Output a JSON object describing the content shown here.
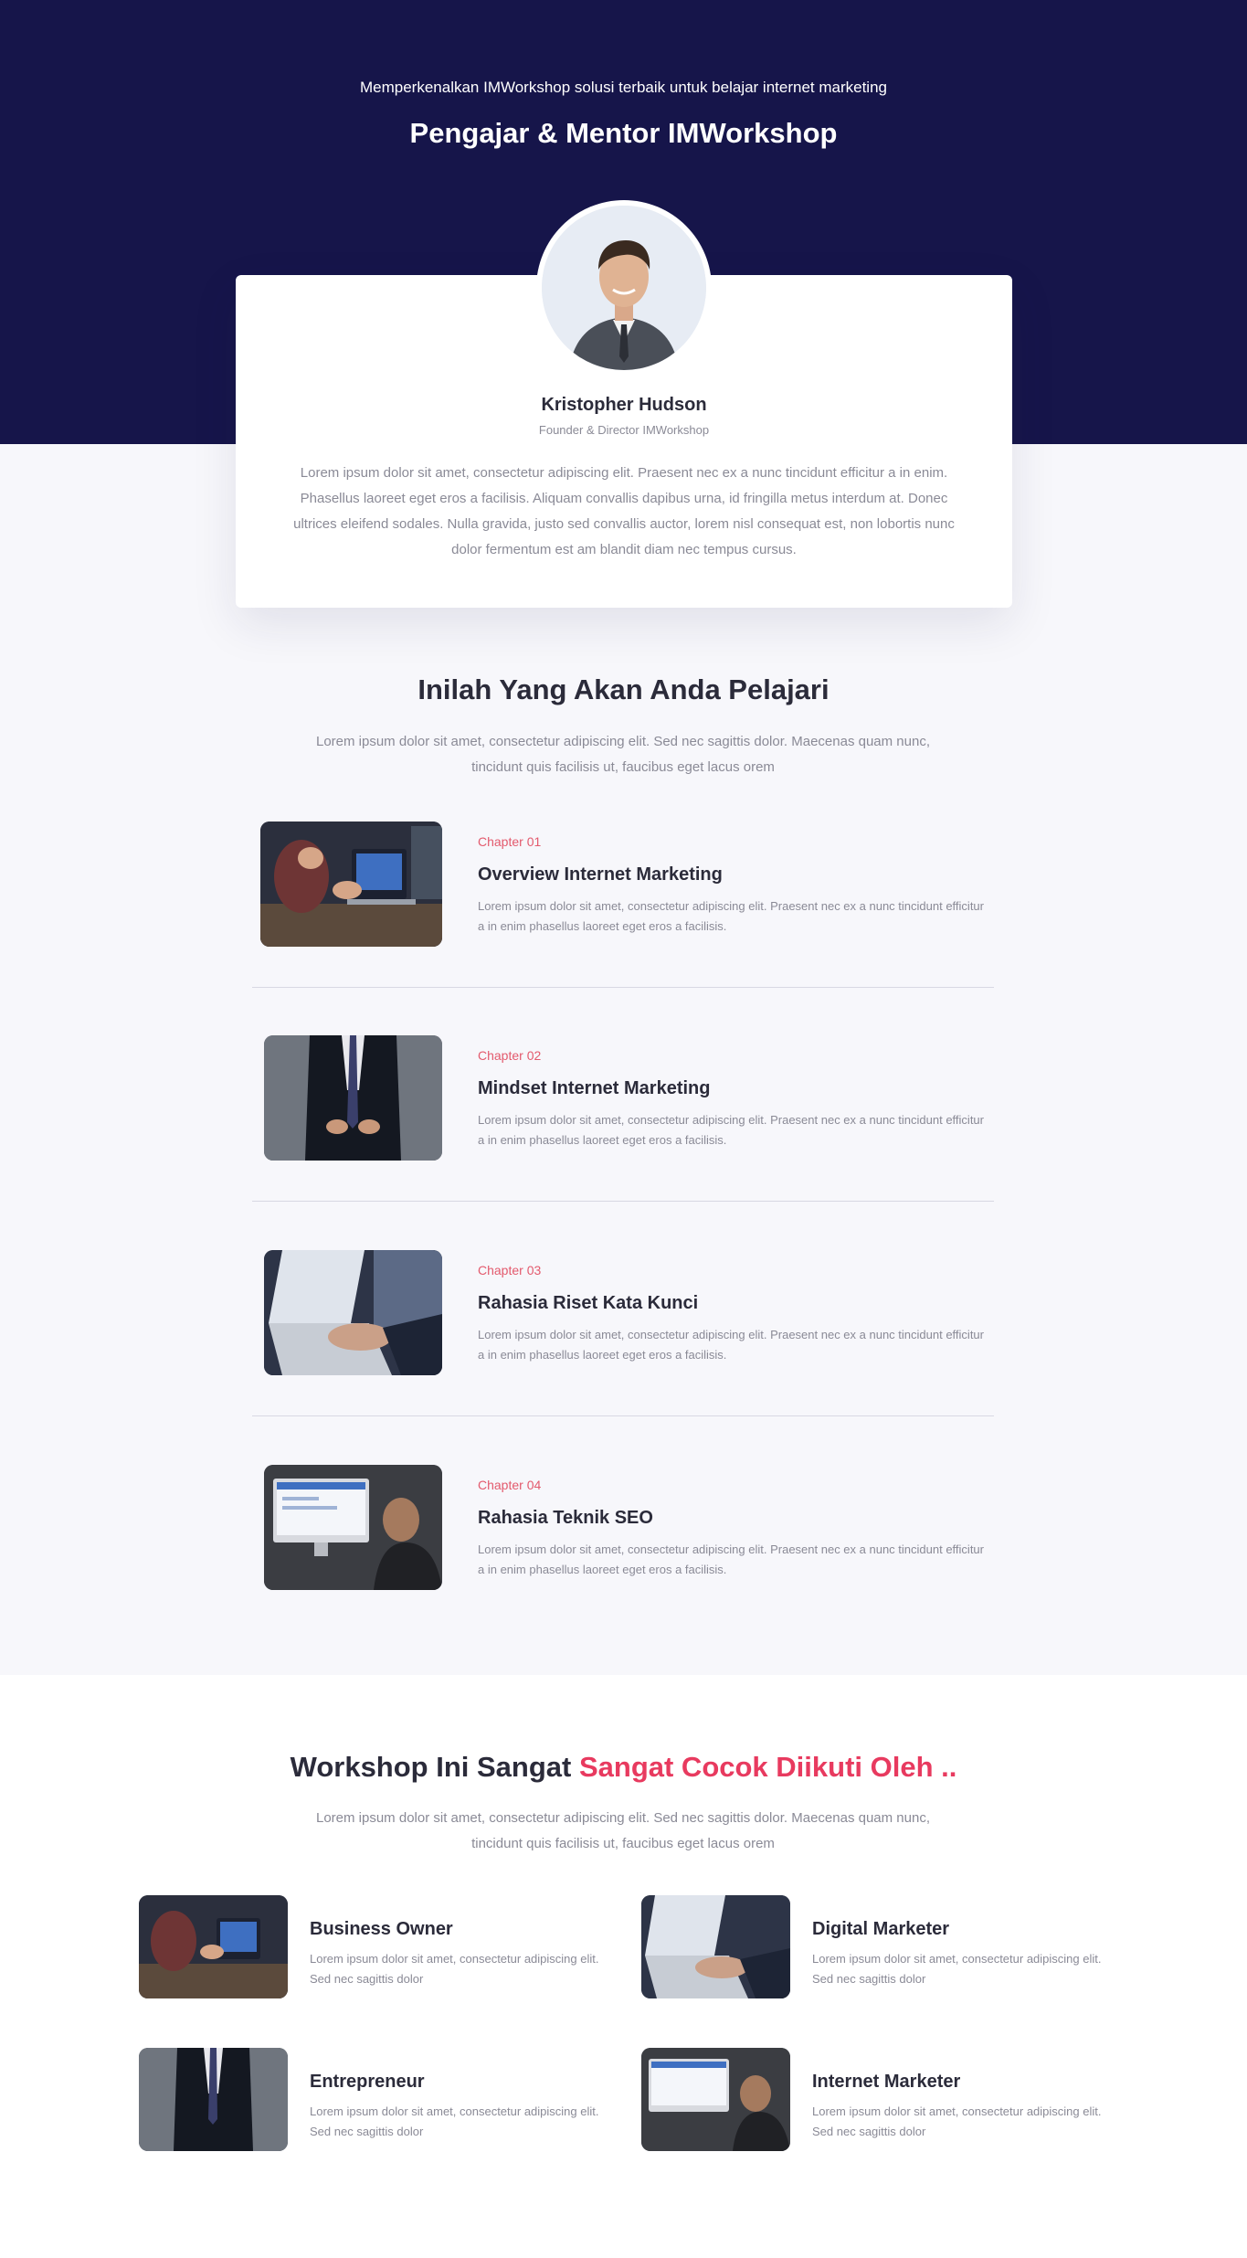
{
  "hero": {
    "kicker": "Memperkenalkan IMWorkshop solusi terbaik untuk belajar internet marketing",
    "title": "Pengajar & Mentor IMWorkshop"
  },
  "mentor": {
    "name": "Kristopher Hudson",
    "role": "Founder & Director IMWorkshop",
    "bio": "Lorem ipsum dolor sit amet, consectetur adipiscing elit. Praesent nec ex a nunc tincidunt efficitur a in enim. Phasellus laoreet eget eros a facilisis. Aliquam convallis dapibus urna, id fringilla metus interdum at. Donec ultrices eleifend sodales. Nulla gravida, justo sed convallis auctor, lorem nisl consequat est, non lobortis nunc dolor fermentum est am blandit diam nec tempus cursus."
  },
  "learn": {
    "title": "Inilah Yang Akan Anda Pelajari",
    "subtitle": "Lorem ipsum dolor sit amet, consectetur adipiscing elit. Sed nec sagittis dolor. Maecenas quam nunc, tincidunt quis facilisis ut, faucibus eget lacus orem",
    "chapters": [
      {
        "label": "Chapter 01",
        "title": "Overview Internet Marketing",
        "desc": "Lorem ipsum dolor sit amet, consectetur adipiscing elit. Praesent nec ex a nunc tincidunt efficitur a in enim phasellus laoreet eget eros a facilisis."
      },
      {
        "label": "Chapter 02",
        "title": "Mindset Internet Marketing",
        "desc": "Lorem ipsum dolor sit amet, consectetur adipiscing elit. Praesent nec ex a nunc tincidunt efficitur a in enim phasellus laoreet eget eros a facilisis."
      },
      {
        "label": "Chapter 03",
        "title": "Rahasia Riset Kata Kunci",
        "desc": "Lorem ipsum dolor sit amet, consectetur adipiscing elit. Praesent nec ex a nunc tincidunt efficitur a in enim phasellus laoreet eget eros a facilisis."
      },
      {
        "label": "Chapter 04",
        "title": "Rahasia Teknik SEO",
        "desc": "Lorem ipsum dolor sit amet, consectetur adipiscing elit. Praesent nec ex a nunc tincidunt efficitur a in enim phasellus laoreet eget eros a facilisis."
      }
    ]
  },
  "audience": {
    "title_start": "Workshop Ini Sangat ",
    "title_accent": "Sangat Cocok Diikuti Oleh ..",
    "subtitle": "Lorem ipsum dolor sit amet, consectetur adipiscing elit. Sed nec sagittis dolor. Maecenas quam nunc, tincidunt quis facilisis ut, faucibus eget lacus orem",
    "items": [
      {
        "title": "Business Owner",
        "desc": "Lorem ipsum dolor sit amet, consectetur adipiscing elit. Sed nec sagittis dolor"
      },
      {
        "title": "Digital Marketer",
        "desc": "Lorem ipsum dolor sit amet, consectetur adipiscing elit. Sed nec sagittis dolor"
      },
      {
        "title": "Entrepreneur",
        "desc": "Lorem ipsum dolor sit amet, consectetur adipiscing elit. Sed nec sagittis dolor"
      },
      {
        "title": "Internet Marketer",
        "desc": "Lorem ipsum dolor sit amet, consectetur adipiscing elit. Sed nec sagittis dolor"
      }
    ]
  },
  "colors": {
    "hero_bg": "#16154a",
    "accent": "#e83a5f",
    "chapter_label": "#e35a6d",
    "page_bg": "#f7f7fb"
  }
}
